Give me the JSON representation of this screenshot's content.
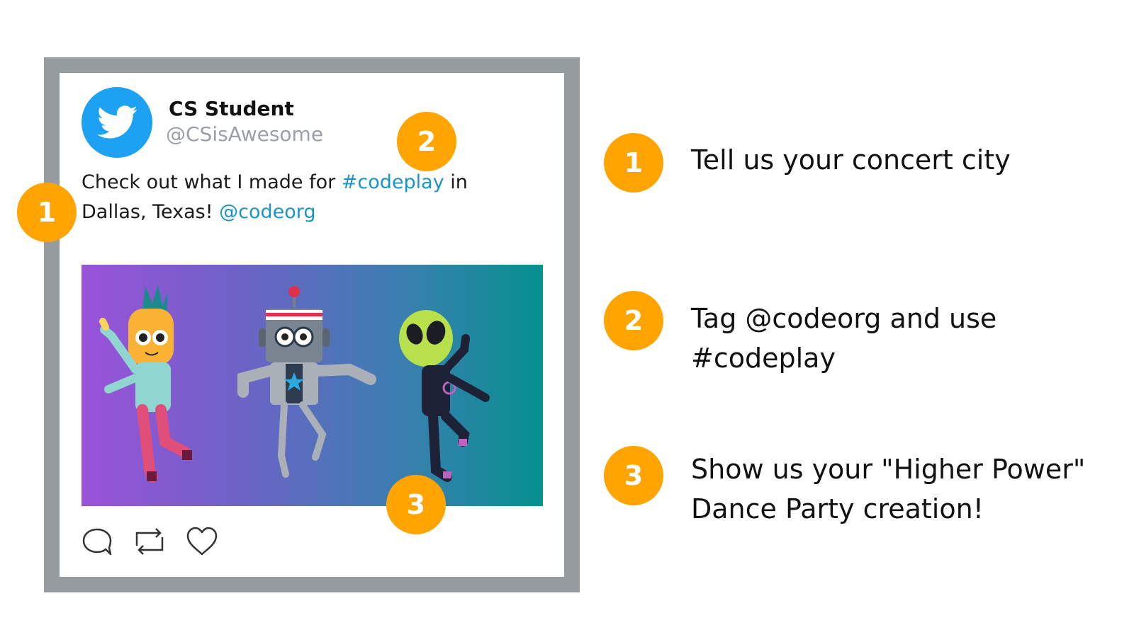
{
  "tweet": {
    "display_name": "CS Student",
    "handle": "@CSisAwesome",
    "text_part1": "Check out what I made for ",
    "hashtag": "#codeplay",
    "text_part2": " in Dallas, Texas!  ",
    "mention": "@codeorg",
    "avatar_icon": "twitter-bird-icon",
    "brand_color": "#1da1f2",
    "link_color": "#1b95c9",
    "actions": [
      {
        "icon": "reply-icon"
      },
      {
        "icon": "retweet-icon"
      },
      {
        "icon": "like-icon"
      }
    ]
  },
  "callouts": [
    {
      "number": "1",
      "text": "Tell us your concert city"
    },
    {
      "number": "2",
      "text": "Tag @codeorg and use #codeplay"
    },
    {
      "number": "3",
      "text": "Show us your \"Higher Power\" Dance Party creation!"
    }
  ],
  "badge_color": "#ffa400",
  "image_characters": [
    "pineapple",
    "robot",
    "alien"
  ]
}
